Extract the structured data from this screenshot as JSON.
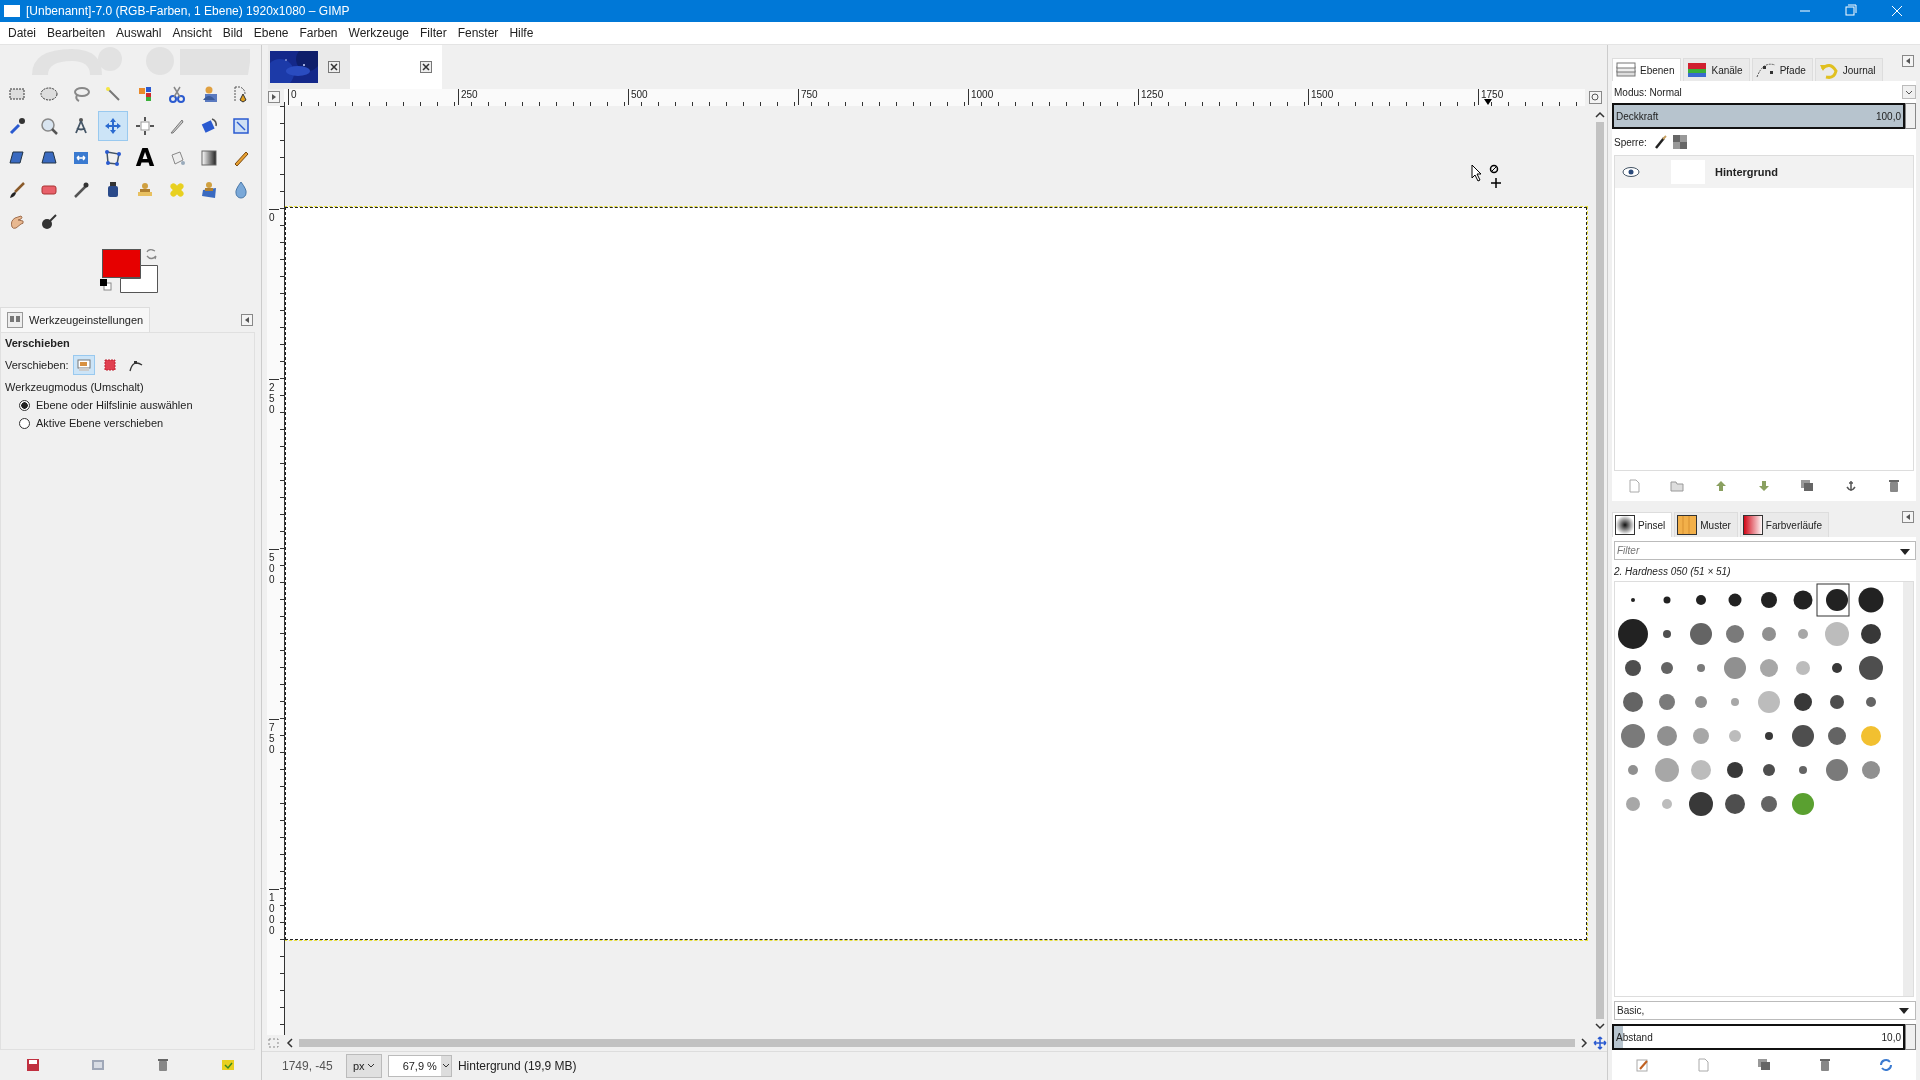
{
  "window": {
    "title": "[Unbenannt]-7.0 (RGB-Farben, 1 Ebene) 1920x1080 – GIMP"
  },
  "menu": [
    "Datei",
    "Bearbeiten",
    "Auswahl",
    "Ansicht",
    "Bild",
    "Ebene",
    "Farben",
    "Werkzeuge",
    "Filter",
    "Fenster",
    "Hilfe"
  ],
  "toolbox": {
    "tools": [
      {
        "kind": "rect",
        "selected": false
      },
      {
        "kind": "ellipse",
        "selected": false
      },
      {
        "kind": "lasso",
        "selected": false
      },
      {
        "kind": "wand",
        "selected": false
      },
      {
        "kind": "bycolor",
        "selected": false
      },
      {
        "kind": "scissors",
        "selected": false
      },
      {
        "kind": "fgselect",
        "selected": false
      },
      {
        "kind": "paths",
        "selected": false
      },
      {
        "kind": "picker",
        "selected": false
      },
      {
        "kind": "zoom",
        "selected": false
      },
      {
        "kind": "measure",
        "selected": false
      },
      {
        "kind": "move",
        "selected": true
      },
      {
        "kind": "align",
        "selected": false
      },
      {
        "kind": "crop",
        "selected": false
      },
      {
        "kind": "rotate",
        "selected": false
      },
      {
        "kind": "scale",
        "selected": false
      },
      {
        "kind": "shear",
        "selected": false
      },
      {
        "kind": "perspective",
        "selected": false
      },
      {
        "kind": "flip",
        "selected": false
      },
      {
        "kind": "cage",
        "selected": false
      },
      {
        "kind": "text",
        "glyph": "A",
        "selected": false
      },
      {
        "kind": "bucket",
        "selected": false
      },
      {
        "kind": "gradient",
        "selected": false
      },
      {
        "kind": "pencil",
        "selected": false
      },
      {
        "kind": "brush",
        "selected": false
      },
      {
        "kind": "eraser",
        "selected": false
      },
      {
        "kind": "airbrush",
        "selected": false
      },
      {
        "kind": "ink",
        "selected": false
      },
      {
        "kind": "clone",
        "selected": false
      },
      {
        "kind": "heal",
        "selected": false
      },
      {
        "kind": "perspclone",
        "selected": false
      },
      {
        "kind": "blur",
        "selected": false
      },
      {
        "kind": "smudge",
        "selected": false
      },
      {
        "kind": "dodge",
        "selected": false
      }
    ],
    "swatches": [
      {
        "kind": "foreground",
        "color": "#e60000"
      },
      {
        "kind": "background",
        "color": "#ffffff"
      }
    ]
  },
  "tool_options": {
    "tab": "Werkzeugeinstellungen",
    "title": "Verschieben",
    "move_label": "Verschieben:",
    "move_targets": [
      {
        "kind": "layer",
        "selected": true
      },
      {
        "kind": "selection",
        "selected": false
      },
      {
        "kind": "path",
        "selected": false
      }
    ],
    "mode_label": "Werkzeugmodus (Umschalt)",
    "modes": [
      {
        "label": "Ebene oder Hilfslinie auswählen",
        "selected": true
      },
      {
        "label": "Aktive Ebene verschieben",
        "selected": false
      }
    ]
  },
  "image_tabs": [
    {
      "kind": "picture",
      "selected": false
    },
    {
      "kind": "blank",
      "selected": true
    }
  ],
  "rulers": {
    "horizontal": [
      "0",
      "250",
      "500",
      "750",
      "1000",
      "1250",
      "1500",
      "1750"
    ],
    "vertical": [
      "0",
      "250",
      "500",
      "750",
      "1000"
    ]
  },
  "layers_dock": {
    "tabs": [
      {
        "label": "Ebenen",
        "kind": "layers",
        "selected": true
      },
      {
        "label": "Kanäle",
        "kind": "channels",
        "selected": false
      },
      {
        "label": "Pfade",
        "kind": "paths",
        "selected": false
      },
      {
        "label": "Journal",
        "kind": "journal",
        "selected": false
      }
    ],
    "mode": "Modus: Normal",
    "opacity": {
      "label": "Deckkraft",
      "reading": "100,0",
      "level": 1
    },
    "lock_label": "Sperre:",
    "layers": [
      {
        "name": "Hintergrund",
        "visible": true
      }
    ]
  },
  "brushes_dock": {
    "tabs": [
      {
        "label": "Pinsel",
        "kind": "brushes",
        "selected": true
      },
      {
        "label": "Muster",
        "kind": "patterns",
        "selected": false
      },
      {
        "label": "Farbverläufe",
        "kind": "gradients",
        "selected": false
      }
    ],
    "filter": {
      "placeholder": "Filter"
    },
    "brush_name": "2. Hardness 050 (51 × 51)",
    "preset": "Basic,",
    "spacing": {
      "label": "Abstand",
      "reading": "10,0",
      "level": 0.03
    }
  },
  "status_bar": {
    "coordinates": "1749, -45",
    "unit": "px",
    "zoom": "67,9 %",
    "info": "Hintergrund (19,9 MB)"
  }
}
